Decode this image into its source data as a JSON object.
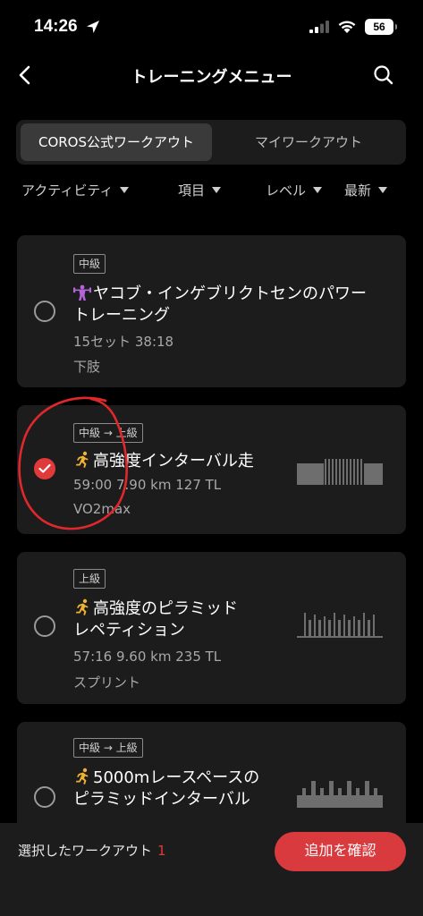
{
  "status_bar": {
    "time": "14:26",
    "battery": "56"
  },
  "nav": {
    "title": "トレーニングメニュー",
    "back_icon": "chevron-left-icon",
    "search_icon": "search-icon"
  },
  "segment": {
    "official": "COROS公式ワークアウト",
    "mine": "マイワークアウト",
    "selected": "official"
  },
  "filters": {
    "activity": "アクティビティ",
    "item": "項目",
    "level": "レベル",
    "sort": "最新"
  },
  "workouts": [
    {
      "level": "中級",
      "icon": "strength-icon",
      "name_l1": "ヤコブ・インゲブリクトセンのパワー",
      "name_l2": "トレーニング",
      "meta": "15セット 38:18",
      "tag": "下肢",
      "selected": false
    },
    {
      "level": "中級 → 上級",
      "icon": "runner-icon",
      "name_l1": "高強度インターバル走",
      "name_l2": "",
      "meta": "59:00 7.90 km 127 TL",
      "tag": "VO2max",
      "selected": true
    },
    {
      "level": "上級",
      "icon": "runner-icon",
      "name_l1": "高強度のピラミッド",
      "name_l2": "レペティション",
      "meta": "57:16 9.60 km 235 TL",
      "tag": "スプリント",
      "selected": false
    },
    {
      "level": "中級 → 上級",
      "icon": "runner-icon",
      "name_l1": "5000mレースペースの",
      "name_l2": "ピラミッドインターバル",
      "meta": "",
      "tag": "",
      "selected": false
    }
  ],
  "bottom": {
    "selected_label": "選択したワークアウト",
    "selected_count": "1",
    "confirm": "追加を確認"
  },
  "colors": {
    "accent": "#d93a3e",
    "card": "#1c1c1c",
    "runner": "#f0b232",
    "strength": "#b565d9"
  }
}
